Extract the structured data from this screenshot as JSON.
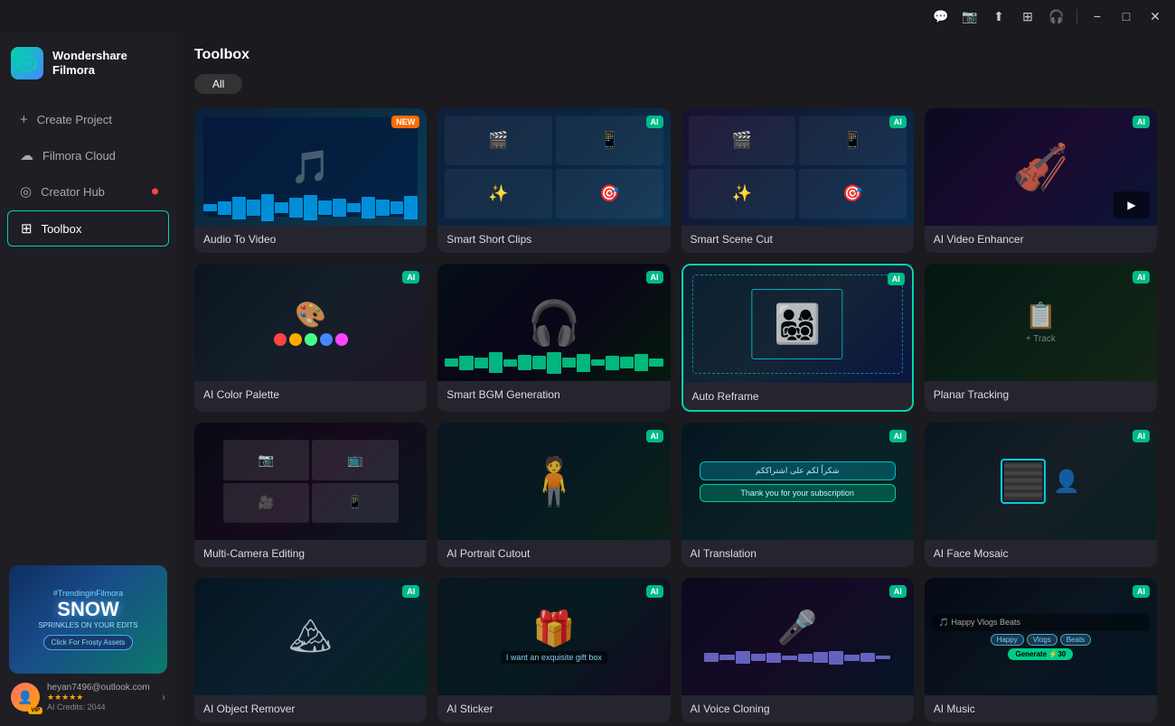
{
  "titlebar": {
    "minimize_label": "−",
    "maximize_label": "□",
    "close_label": "✕"
  },
  "sidebar": {
    "logo": {
      "brand": "Wondershare",
      "product": "Filmora"
    },
    "nav_items": [
      {
        "id": "create-project",
        "label": "Create Project",
        "icon": "+"
      },
      {
        "id": "filmora-cloud",
        "label": "Filmora Cloud",
        "icon": "☁"
      },
      {
        "id": "creator-hub",
        "label": "Creator Hub",
        "icon": "◎",
        "has_dot": true
      },
      {
        "id": "toolbox",
        "label": "Toolbox",
        "icon": "⊞",
        "active": true
      }
    ],
    "promo": {
      "hashtag": "#TrendinginFilmora",
      "headline": "SNOW",
      "subtext": "SPRINKLES ON YOUR EDITS",
      "button_label": "Click For Frosty Assets"
    },
    "user": {
      "email": "heyan7496@outlook.com",
      "stars": "★★★★★",
      "credits": "AI Credits: 2044",
      "vip_label": "VIP"
    }
  },
  "main": {
    "page_title": "Toolbox",
    "filter_tabs": [
      {
        "id": "all",
        "label": "All",
        "active": true
      }
    ],
    "tools": [
      {
        "id": "audio-to-video",
        "label": "Audio To Video",
        "badge": "NEW",
        "badge_type": "new",
        "thumb_class": "thumb-audio-video",
        "icon": "🎵"
      },
      {
        "id": "smart-short-clips",
        "label": "Smart Short Clips",
        "badge": "AI",
        "badge_type": "ai",
        "thumb_class": "thumb-smart-short",
        "icon": "✂"
      },
      {
        "id": "smart-scene-cut",
        "label": "Smart Scene Cut",
        "badge": "AI",
        "badge_type": "ai",
        "thumb_class": "thumb-smart-scene",
        "icon": "🎬"
      },
      {
        "id": "ai-video-enhancer",
        "label": "AI Video Enhancer",
        "badge": "AI",
        "badge_type": "ai",
        "thumb_class": "thumb-ai-video",
        "icon": "🎻"
      },
      {
        "id": "ai-color-palette",
        "label": "AI Color Palette",
        "badge": "AI",
        "badge_type": "ai",
        "thumb_class": "thumb-ai-color",
        "icon": "🎨"
      },
      {
        "id": "smart-bgm-generation",
        "label": "Smart BGM Generation",
        "badge": "AI",
        "badge_type": "ai",
        "thumb_class": "thumb-smart-bgm",
        "icon": "🎧"
      },
      {
        "id": "auto-reframe",
        "label": "Auto Reframe",
        "badge": "AI",
        "badge_type": "ai",
        "thumb_class": "thumb-auto-reframe",
        "icon": "⊞",
        "highlighted": true
      },
      {
        "id": "planar-tracking",
        "label": "Planar Tracking",
        "badge": "AI",
        "badge_type": "ai",
        "thumb_class": "thumb-planar",
        "icon": "📊"
      },
      {
        "id": "multi-camera-editing",
        "label": "Multi-Camera Editing",
        "badge": null,
        "thumb_class": "thumb-multicam",
        "icon": "📷"
      },
      {
        "id": "ai-portrait-cutout",
        "label": "AI Portrait Cutout",
        "badge": "AI",
        "badge_type": "ai",
        "thumb_class": "thumb-portrait",
        "icon": "👤"
      },
      {
        "id": "ai-translation",
        "label": "AI Translation",
        "badge": "AI",
        "badge_type": "ai",
        "thumb_class": "thumb-ai-trans",
        "icon": "💬"
      },
      {
        "id": "ai-face-mosaic",
        "label": "AI Face Mosaic",
        "badge": "AI",
        "badge_type": "ai",
        "thumb_class": "thumb-ai-face",
        "icon": "😶"
      },
      {
        "id": "ai-object-remover",
        "label": "AI Object Remover",
        "badge": "AI",
        "badge_type": "ai",
        "thumb_class": "thumb-ai-obj",
        "icon": "🏔"
      },
      {
        "id": "ai-sticker",
        "label": "AI Sticker",
        "badge": "AI",
        "badge_type": "ai",
        "thumb_class": "thumb-ai-sticker",
        "icon": "🎁"
      },
      {
        "id": "ai-voice-cloning",
        "label": "AI Voice Cloning",
        "badge": "AI",
        "badge_type": "ai",
        "thumb_class": "thumb-ai-voice",
        "icon": "🎤"
      },
      {
        "id": "ai-music",
        "label": "AI Music",
        "badge": "AI",
        "badge_type": "ai",
        "thumb_class": "thumb-ai-music",
        "icon": "🎵"
      }
    ]
  },
  "icons": {
    "message": "💬",
    "camera": "📷",
    "upload": "⬆",
    "grid": "⊞",
    "headphone": "🎧",
    "minimize": "─",
    "maximize": "□",
    "close": "✕"
  }
}
